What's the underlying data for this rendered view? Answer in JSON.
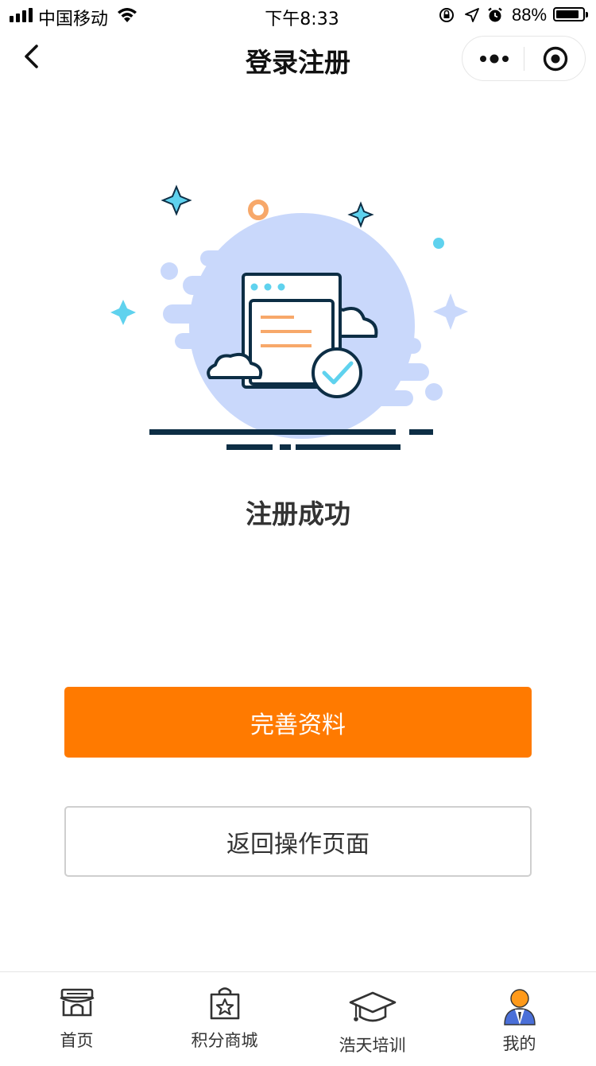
{
  "status_bar": {
    "carrier": "中国移动",
    "time": "下午8:33",
    "battery": "88%",
    "battery_level": 0.88
  },
  "nav": {
    "title": "登录注册",
    "back_icon": "chevron-left-icon",
    "more_icon": "more-dots-icon",
    "close_icon": "target-close-icon"
  },
  "main": {
    "illustration": "registration-success-illustration",
    "result_text": "注册成功",
    "primary_button": "完善资料",
    "secondary_button": "返回操作页面"
  },
  "colors": {
    "accent": "#ff7a00",
    "illustration_blue": "#c9d8fb",
    "dark_navy": "#0d2e45",
    "cyan": "#5fd2ee",
    "orange_light": "#f7a86a"
  },
  "tab_bar": {
    "tabs": [
      {
        "label": "首页",
        "icon": "storefront-icon"
      },
      {
        "label": "积分商城",
        "icon": "shopping-bag-star-icon"
      },
      {
        "label": "浩天培训",
        "icon": "graduation-cap-icon"
      },
      {
        "label": "我的",
        "icon": "user-profile-icon"
      }
    ]
  }
}
